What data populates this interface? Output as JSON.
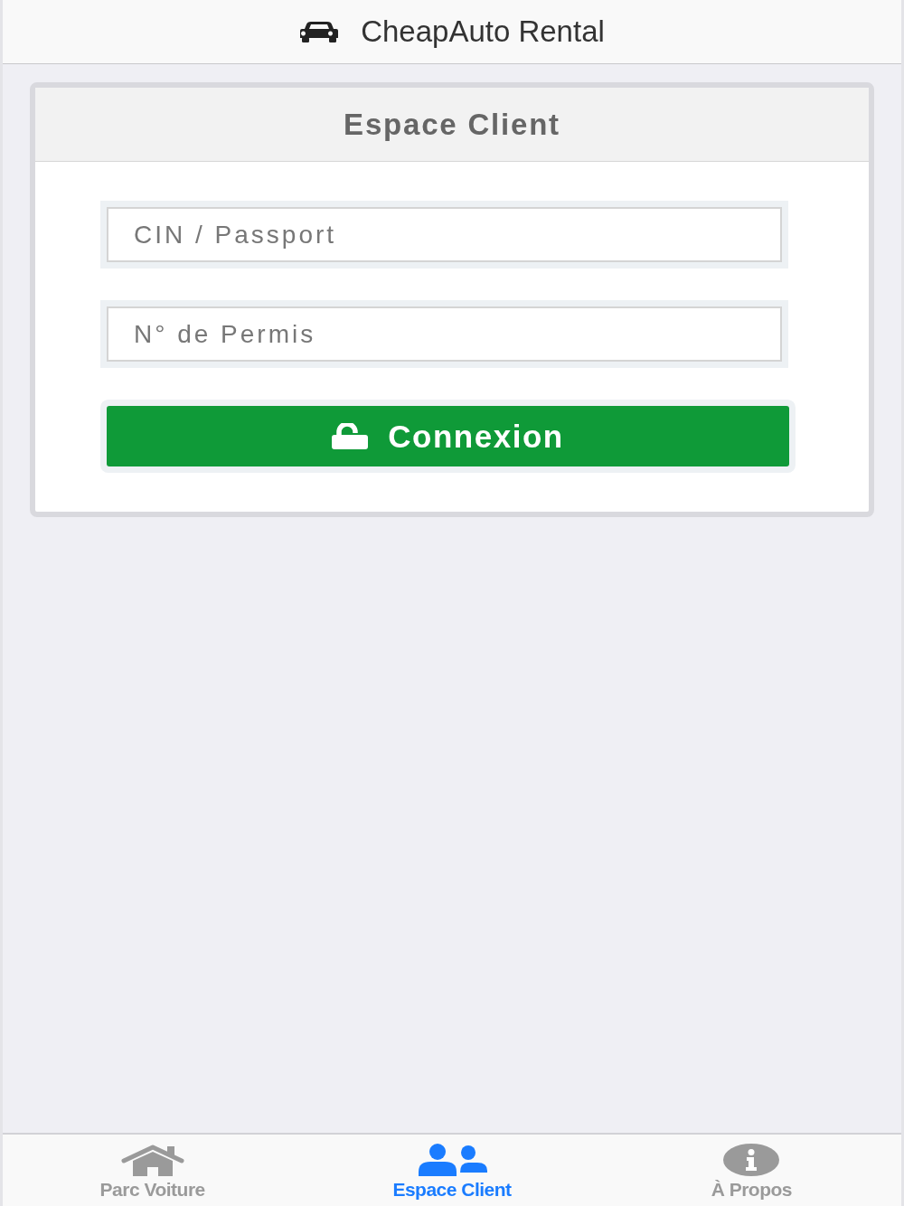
{
  "header": {
    "title": "CheapAuto Rental"
  },
  "card": {
    "title": "Espace Client",
    "fields": [
      {
        "placeholder": "CIN / Passport"
      },
      {
        "placeholder": "N° de Permis"
      }
    ],
    "submit": {
      "label": "Connexion"
    }
  },
  "tab_bar": {
    "tabs": [
      {
        "label": "Parc Voiture",
        "selected": false
      },
      {
        "label": "Espace Client",
        "selected": true
      },
      {
        "label": "À Propos",
        "selected": false
      }
    ]
  }
}
